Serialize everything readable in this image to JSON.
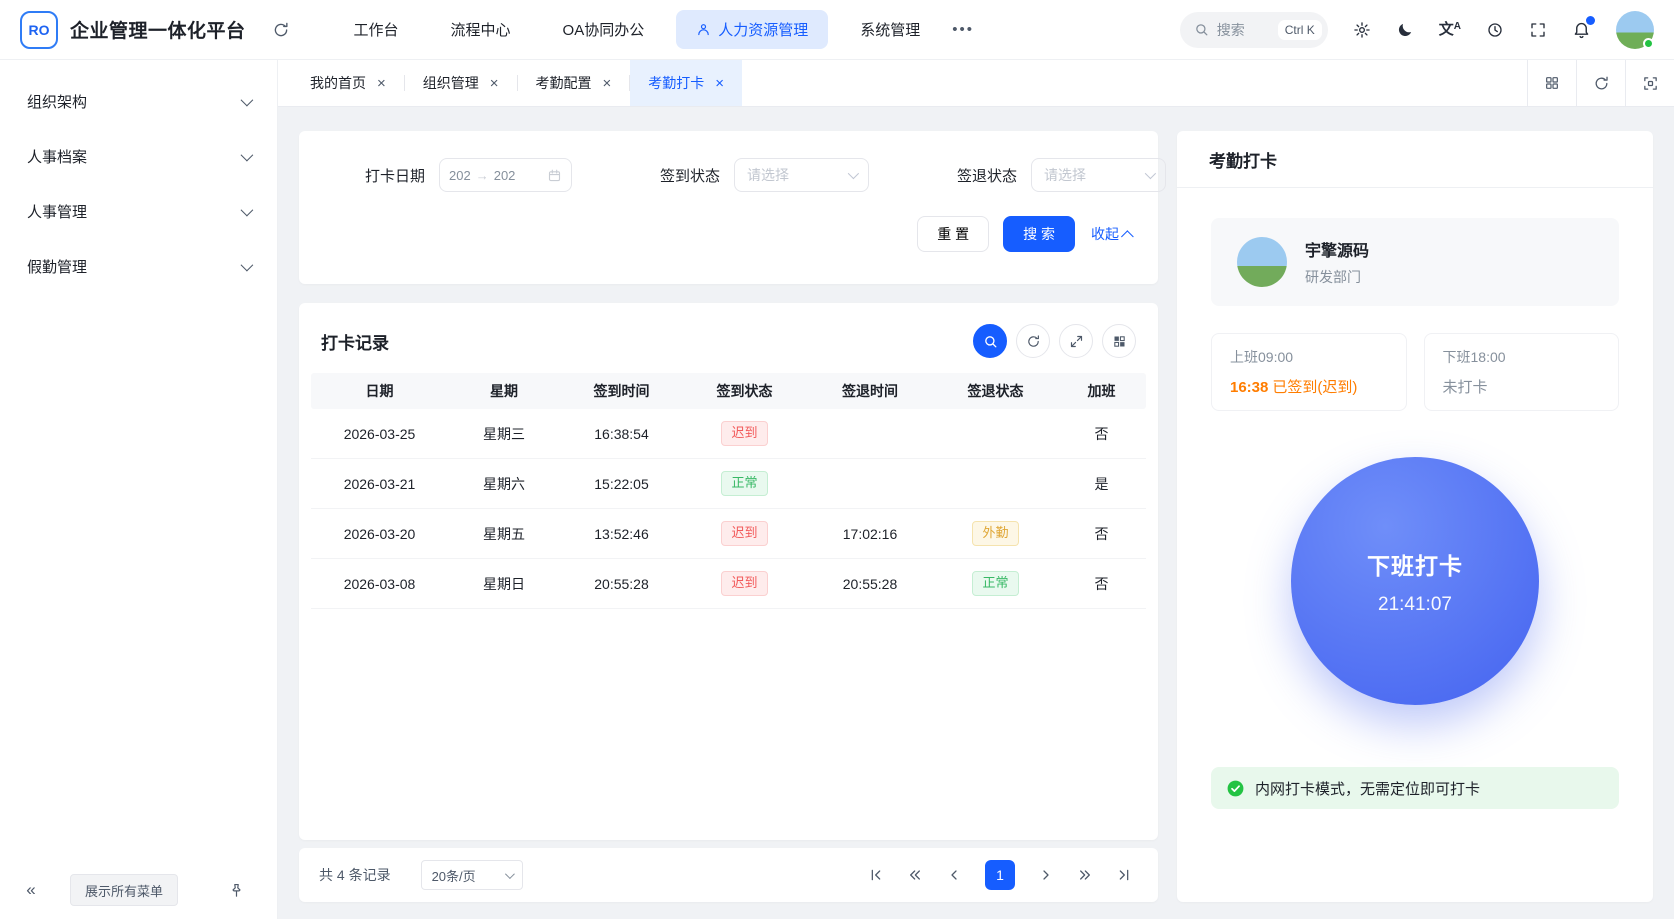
{
  "navbar": {
    "logo_text": "RO",
    "title": "企业管理一体化平台",
    "items": [
      {
        "label": "工作台",
        "active": false
      },
      {
        "label": "流程中心",
        "active": false
      },
      {
        "label": "OA协同办公",
        "active": false
      },
      {
        "label": "人力资源管理",
        "active": true
      },
      {
        "label": "系统管理",
        "active": false
      }
    ],
    "search": {
      "placeholder": "搜索",
      "shortcut": "Ctrl K"
    }
  },
  "sidebar": {
    "items": [
      "组织架构",
      "人事档案",
      "人事管理",
      "假勤管理"
    ],
    "show_all_label": "展示所有菜单"
  },
  "tabs": [
    {
      "label": "我的首页",
      "active": false
    },
    {
      "label": "组织管理",
      "active": false
    },
    {
      "label": "考勤配置",
      "active": false
    },
    {
      "label": "考勤打卡",
      "active": true
    }
  ],
  "filter": {
    "date_label": "打卡日期",
    "date_start": "202",
    "date_end": "202",
    "checkin_label": "签到状态",
    "checkout_label": "签退状态",
    "select_placeholder": "请选择",
    "reset_label": "重 置",
    "search_label": "搜 索",
    "collapse_label": "收起"
  },
  "table": {
    "title": "打卡记录",
    "columns": [
      "日期",
      "星期",
      "签到时间",
      "签到状态",
      "签退时间",
      "签退状态",
      "加班"
    ],
    "rows": [
      {
        "date": "2026-03-25",
        "week": "星期三",
        "checkin": "16:38:54",
        "checkin_status": "迟到",
        "checkin_type": "late",
        "checkout": "",
        "checkout_status": "",
        "checkout_type": "",
        "overtime": "否"
      },
      {
        "date": "2026-03-21",
        "week": "星期六",
        "checkin": "15:22:05",
        "checkin_status": "正常",
        "checkin_type": "normal",
        "checkout": "",
        "checkout_status": "",
        "checkout_type": "",
        "overtime": "是"
      },
      {
        "date": "2026-03-20",
        "week": "星期五",
        "checkin": "13:52:46",
        "checkin_status": "迟到",
        "checkin_type": "late",
        "checkout": "17:02:16",
        "checkout_status": "外勤",
        "checkout_type": "field",
        "overtime": "否"
      },
      {
        "date": "2026-03-08",
        "week": "星期日",
        "checkin": "20:55:28",
        "checkin_status": "迟到",
        "checkin_type": "late",
        "checkout": "20:55:28",
        "checkout_status": "正常",
        "checkout_type": "normal",
        "overtime": "否"
      }
    ]
  },
  "pagination": {
    "total_text": "共 4 条记录",
    "page_size": "20条/页",
    "current_page": "1"
  },
  "panel": {
    "title": "考勤打卡",
    "user": {
      "name": "宇擎源码",
      "dept": "研发部门"
    },
    "shift_in": {
      "label": "上班09:00",
      "time": "16:38",
      "status": "已签到(迟到)"
    },
    "shift_out": {
      "label": "下班18:00",
      "status": "未打卡"
    },
    "punch_button": {
      "label": "下班打卡",
      "time": "21:41:07"
    },
    "notice": "内网打卡模式，无需定位即可打卡"
  }
}
